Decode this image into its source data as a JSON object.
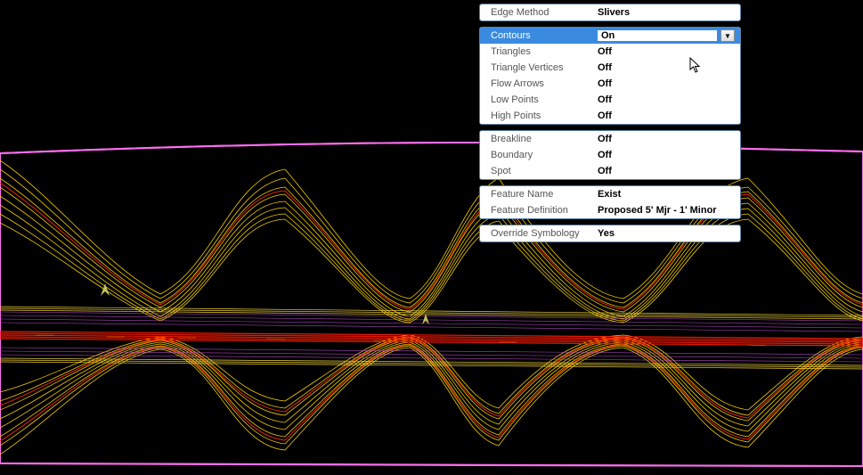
{
  "panel_edge": {
    "edge_method_label": "Edge Method",
    "edge_method_value": "Slivers"
  },
  "panel_display": {
    "items": [
      {
        "label": "Contours",
        "value": "On",
        "selected": true
      },
      {
        "label": "Triangles",
        "value": "Off"
      },
      {
        "label": "Triangle Vertices",
        "value": "Off"
      },
      {
        "label": "Flow Arrows",
        "value": "Off"
      },
      {
        "label": "Low Points",
        "value": "Off"
      },
      {
        "label": "High Points",
        "value": "Off"
      }
    ]
  },
  "panel_lines": {
    "items": [
      {
        "label": "Breakline",
        "value": "Off"
      },
      {
        "label": "Boundary",
        "value": "Off"
      },
      {
        "label": "Spot",
        "value": "Off"
      }
    ]
  },
  "panel_feature": {
    "feature_name_label": "Feature Name",
    "feature_name_value": "Exist",
    "feature_def_label": "Feature Definition",
    "feature_def_value": "Proposed 5' Mjr - 1' Minor"
  },
  "panel_override": {
    "override_label": "Override Symbology",
    "override_value": "Yes"
  }
}
